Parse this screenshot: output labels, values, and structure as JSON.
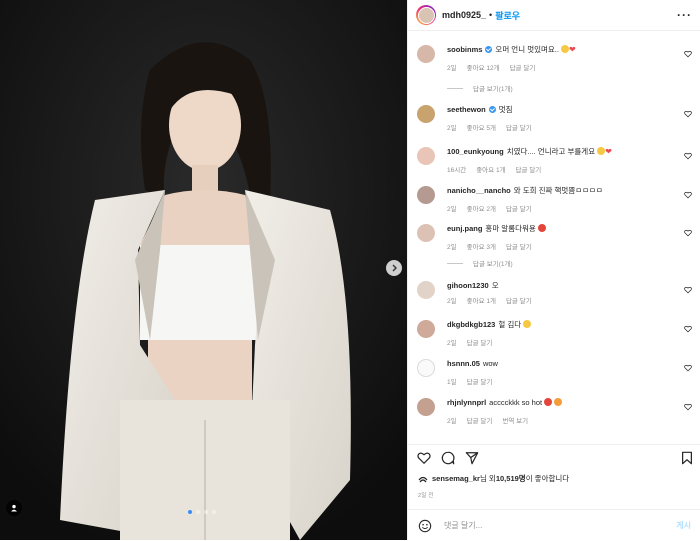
{
  "header": {
    "username": "mdh0925_",
    "separator": "•",
    "follow_label": "팔로우",
    "more_label": "···"
  },
  "comments": [
    {
      "user": "soobinms",
      "verified": true,
      "text": "오머 언니 멋있며요..",
      "time": "2일",
      "likes": "좋아요 12개",
      "reply": "답글 달기",
      "view_replies": "답글 보기(1개)"
    },
    {
      "user": "seethewon",
      "verified": true,
      "text": "멋짐",
      "time": "2일",
      "likes": "좋아요 5개",
      "reply": "답글 달기"
    },
    {
      "user": "100_eunkyoung",
      "verified": false,
      "text": "치였다.... 언니라고 부를게요",
      "time": "16시간",
      "likes": "좋아요 1개",
      "reply": "답글 달기"
    },
    {
      "user": "nanicho__nancho",
      "verified": false,
      "text": "와 도희 진짜 핵멋쁨ㅁㅁㅁㅁ",
      "time": "2일",
      "likes": "좋아요 2개",
      "reply": "답글 달기"
    },
    {
      "user": "eunj.pang",
      "verified": false,
      "text": "홍마 알롬다워용",
      "time": "2일",
      "likes": "좋아요 3개",
      "reply": "답글 달기",
      "view_replies": "답글 보기(1개)"
    },
    {
      "user": "gihoon1230",
      "verified": false,
      "text": "오",
      "time": "2일",
      "likes": "좋아요 1개",
      "reply": "답글 달기"
    },
    {
      "user": "dkgbdkgb123",
      "verified": false,
      "text": "헐 김다",
      "time": "2일",
      "likes": "",
      "reply": "답글 달기"
    },
    {
      "user": "hsnnn.05",
      "verified": false,
      "text": "wow",
      "time": "1일",
      "likes": "",
      "reply": "답글 달기"
    },
    {
      "user": "rhjnlynnprl",
      "verified": false,
      "text": "acccckkk so hot",
      "time": "2일",
      "likes": "",
      "reply": "답글 달기",
      "translate": "번역 보기"
    }
  ],
  "likes": {
    "user": "sensemag_kr",
    "mid": "님 외 ",
    "count": "10,519명",
    "suffix": "이 좋아합니다"
  },
  "date": "2일 전",
  "add_comment": {
    "placeholder": "댓글 달기...",
    "post_label": "게시"
  },
  "colors": {
    "accent": "#0095f6",
    "like_red": "#ed4956",
    "verified": "#3897f0"
  }
}
